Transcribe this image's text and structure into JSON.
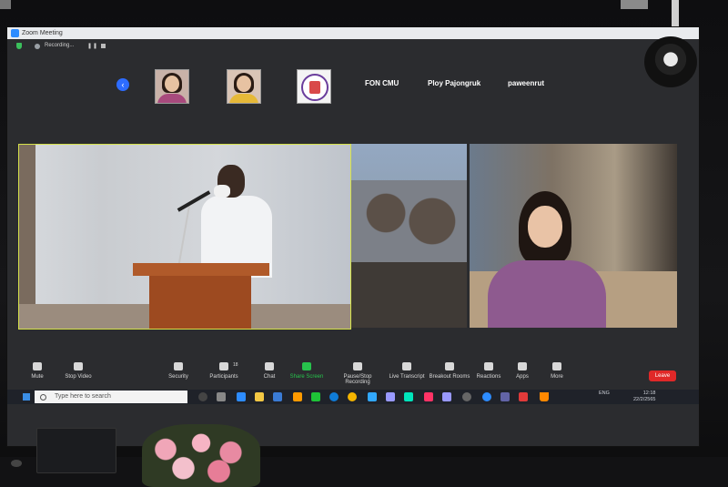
{
  "window": {
    "title": "Zoom Meeting"
  },
  "recording": {
    "status_text": "Recording...",
    "pause_glyph": "❚❚"
  },
  "participants_strip": {
    "prev_glyph": "‹",
    "named_tiles": [
      "FON CMU",
      "Ploy Pajongruk",
      "paweenrut"
    ]
  },
  "toolbar": {
    "participants_count": "18",
    "buttons": [
      "Mute",
      "Stop Video",
      "Security",
      "Participants",
      "Chat",
      "Share Screen",
      "Pause/Stop Recording",
      "Live Transcript",
      "Breakout Rooms",
      "Reactions",
      "Apps",
      "More"
    ],
    "leave_label": "Leave",
    "accent_color": "#27c24c",
    "leave_color": "#e02828"
  },
  "taskbar": {
    "search_placeholder": "Type here to search",
    "language": "ENG",
    "time": "12:18",
    "date": "22/2/2565"
  }
}
